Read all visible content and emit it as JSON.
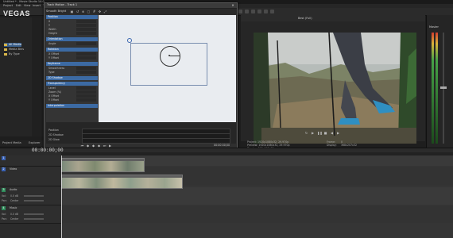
{
  "app": {
    "title": "Untitled * - Movie Studio 14.0",
    "logo": "VEGAS"
  },
  "menu": [
    "Project",
    "Edit",
    "View",
    "Insert",
    "Tools"
  ],
  "explorer": {
    "items": [
      {
        "label": "All Media"
      },
      {
        "label": "Media Bins"
      },
      {
        "label": "By Type"
      }
    ]
  },
  "panel_tabs": [
    "Project Media",
    "Explorer"
  ],
  "track_motion": {
    "title": "Track Motion - Track 1",
    "preset": "Smooth Bright",
    "sections": [
      "Position",
      "Orientation",
      "Rotation",
      "Keyframe",
      "2D Shadow",
      "Transparency",
      "Interpolation"
    ],
    "props": [
      "X",
      "Y",
      "Width",
      "Height",
      "Angle",
      "X Offset",
      "Y Offset",
      "Smoothness",
      "Type",
      "Level",
      "Zoom (%)",
      "X Offset",
      "Y Offset"
    ],
    "timeline_rows": [
      "Position",
      "2D Shadow",
      "2D Glow"
    ],
    "timecode": "00:00:00;00"
  },
  "preview": {
    "quality": "Best (Full)",
    "project": "Project: 1920x1080x32, 29.970p",
    "preview": "Preview: 1920x1080x32, 29.970p",
    "display": "Display: 368x207x32",
    "frame": "Frame:",
    "display_label": "Display:",
    "frame_value": "0",
    "display_value": "368x207x32"
  },
  "master": {
    "label": "Master",
    "value": "-Inf  -Inf"
  },
  "timeline": {
    "timecode": "00:00:00;00"
  },
  "tracks": [
    {
      "num": "1",
      "title": "",
      "controls": []
    },
    {
      "num": "2",
      "title": "Video",
      "controls": []
    },
    {
      "num": "3",
      "title": "Audio",
      "controls": [
        "Vol:",
        "0.0 dB",
        "Pan:",
        "Center"
      ]
    },
    {
      "num": "4",
      "title": "Music",
      "controls": [
        "Vol:",
        "0.0 dB",
        "Pan:",
        "Center"
      ]
    }
  ],
  "colors": {
    "accent": "#3c6aa3",
    "clip_border": "#777777"
  }
}
